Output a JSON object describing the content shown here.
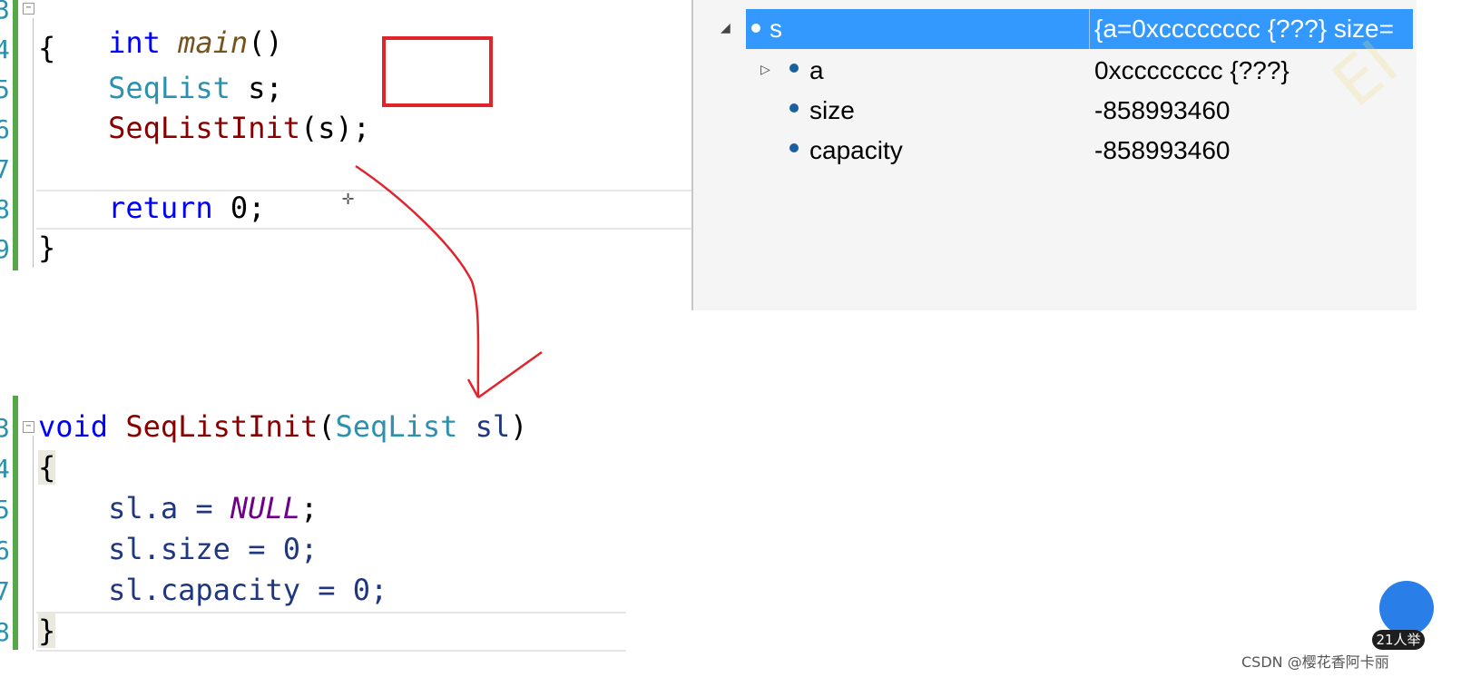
{
  "editor_top": {
    "gutter": [
      "3",
      "4",
      "5",
      "6",
      "7",
      "8",
      "9"
    ],
    "lines": {
      "l1_kw": "int",
      "l1_name": "main",
      "l1_rest": "()",
      "l2": "{",
      "l3_type": "SeqList",
      "l3_rest": " s;",
      "l4_fn": "SeqListInit",
      "l4_rest": "(s);",
      "l6_kw": "return",
      "l6_rest": " 0;",
      "l7": "}"
    }
  },
  "editor_bottom": {
    "gutter": [
      "3",
      "4",
      "5",
      "6",
      "7",
      "8"
    ],
    "lines": {
      "l1_kw": "void",
      "l1_fn": " SeqListInit",
      "l1_open": "(",
      "l1_type": "SeqList",
      "l1_param": " sl",
      "l1_close": ")",
      "l2": "{",
      "l3_a": "sl.a = ",
      "l3_macro": "NULL",
      "l3_end": ";",
      "l4": "sl.size = 0;",
      "l5": "sl.capacity = 0;",
      "l6": "}"
    }
  },
  "watch": {
    "rows": [
      {
        "name": "s",
        "value": "{a=0xcccccccc {???} size=",
        "selected": true,
        "expander": "◢"
      },
      {
        "name": "a",
        "value": "0xcccccccc {???}",
        "expander": "▷"
      },
      {
        "name": "size",
        "value": "-858993460"
      },
      {
        "name": "capacity",
        "value": "-858993460"
      }
    ]
  },
  "overlay": {
    "hand_count": "21人举",
    "watermark": "CSDN @樱花香阿卡丽"
  },
  "colors": {
    "selection": "#3399ff",
    "annotation_red": "#e0242c",
    "change_bar": "#57a64a"
  }
}
